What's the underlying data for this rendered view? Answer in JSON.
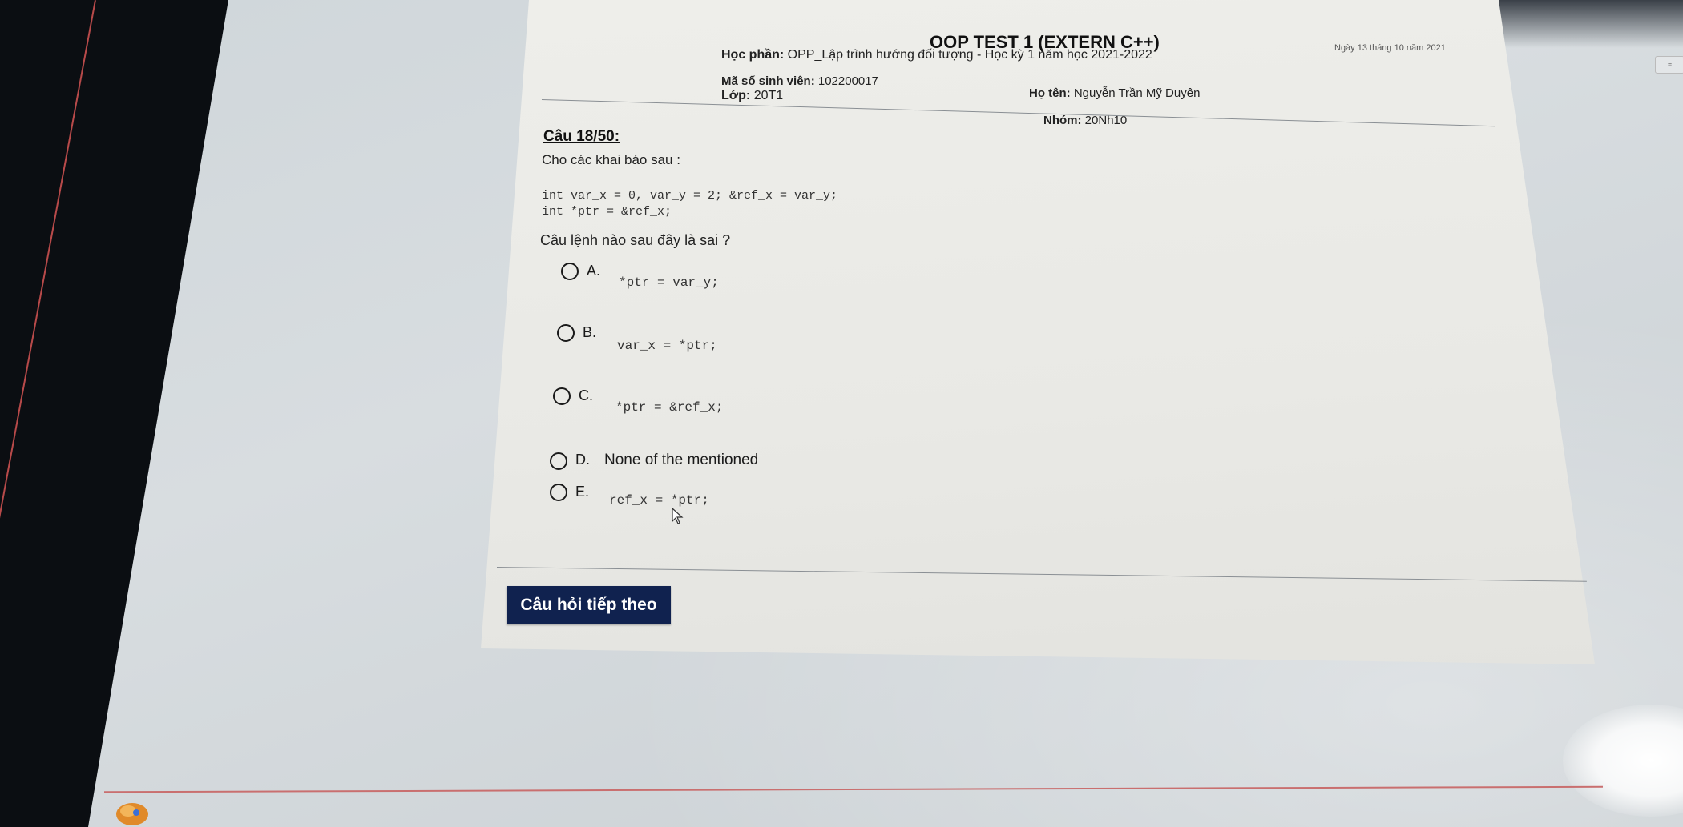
{
  "exam": {
    "title": "OOP TEST 1 (EXTERN C++)",
    "date": "Ngày 13 tháng 10 năm 2021",
    "course_label": "Học phần:",
    "course_value": "OPP_Lập trình hướng đối tượng - Học kỳ 1 năm học 2021-2022",
    "student_id_label": "Mã số sinh viên:",
    "student_id_value": "102200017",
    "class_label": "Lớp:",
    "class_value": "20T1",
    "name_label": "Họ tên:",
    "name_value": "Nguyễn Trần Mỹ Duyên",
    "group_label": "Nhóm:",
    "group_value": "20Nh10"
  },
  "question": {
    "number": "Câu 18/50:",
    "intro": "Cho các khai báo sau :",
    "code_lines": [
      "int var_x = 0, var_y = 2; &ref_x = var_y;",
      "int *ptr = &ref_x;"
    ],
    "prompt": "Câu lệnh nào sau đây là sai ?",
    "options": [
      {
        "letter": "A.",
        "text": "*ptr = var_y;"
      },
      {
        "letter": "B.",
        "text": "var_x = *ptr;"
      },
      {
        "letter": "C.",
        "text": "*ptr = &ref_x;"
      },
      {
        "letter": "D.",
        "text": "None of the mentioned"
      },
      {
        "letter": "E.",
        "text": "ref_x = *ptr;"
      }
    ]
  },
  "buttons": {
    "next_label": "Câu hỏi tiếp theo"
  },
  "colors": {
    "button_bg": "#10224f",
    "paper": "#ebebe7"
  },
  "icons": {
    "cursor": "mouse-pointer-icon",
    "taskbar": "app-taskbar-icon"
  }
}
